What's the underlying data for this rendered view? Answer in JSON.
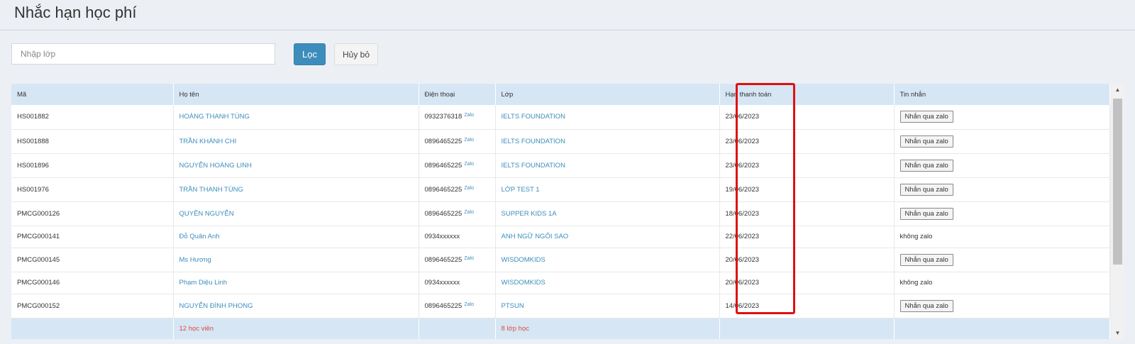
{
  "page": {
    "title": "Nhắc hạn học phí"
  },
  "filter": {
    "placeholder": "Nhập lớp",
    "filter_label": "Lọc",
    "cancel_label": "Hủy bỏ"
  },
  "table": {
    "columns": [
      "Mã",
      "Họ tên",
      "Điện thoại",
      "Lớp",
      "Hạn thanh toán",
      "Tin nhắn"
    ],
    "rows": [
      {
        "code": "HS001882",
        "name": "HOÀNG THANH TÙNG",
        "phone": "0932376318",
        "zalo": "Zalo",
        "class": "IELTS FOUNDATION",
        "due": "23/06/2023",
        "message": "Nhắn qua zalo"
      },
      {
        "code": "HS001888",
        "name": "TRẦN KHÁNH CHI",
        "phone": "0896465225",
        "zalo": "Zalo",
        "class": "IELTS FOUNDATION",
        "due": "23/06/2023",
        "message": "Nhắn qua zalo"
      },
      {
        "code": "HS001896",
        "name": "NGUYỄN HOÀNG LINH",
        "phone": "0896465225",
        "zalo": "Zalo",
        "class": "IELTS FOUNDATION",
        "due": "23/06/2023",
        "message": "Nhắn qua zalo"
      },
      {
        "code": "HS001976",
        "name": "TRẦN THANH TÙNG",
        "phone": "0896465225",
        "zalo": "Zalo",
        "class": "LỚP TEST 1",
        "due": "19/06/2023",
        "message": "Nhắn qua zalo"
      },
      {
        "code": "PMCG000126",
        "name": "QUYÊN NGUYỄN",
        "phone": "0896465225",
        "zalo": "Zalo",
        "class": "SUPPER KIDS 1A",
        "due": "18/06/2023",
        "message": "Nhắn qua zalo"
      },
      {
        "code": "PMCG000141",
        "name": "Đỗ Quân Anh",
        "phone": "0934xxxxxx",
        "zalo": "",
        "class": "ANH NGỮ NGÔI SAO",
        "due": "22/06/2023",
        "message": "không zalo"
      },
      {
        "code": "PMCG000145",
        "name": "Ms Hương",
        "phone": "0896465225",
        "zalo": "Zalo",
        "class": "WISDOMKIDS",
        "due": "20/06/2023",
        "message": "Nhắn qua zalo"
      },
      {
        "code": "PMCG000146",
        "name": "Phạm Diệu Linh",
        "phone": "0934xxxxxx",
        "zalo": "",
        "class": "WISDOMKIDS",
        "due": "20/06/2023",
        "message": "không zalo"
      },
      {
        "code": "PMCG000152",
        "name": "NGUYỄN ĐÌNH PHONG",
        "phone": "0896465225",
        "zalo": "Zalo",
        "class": "PTSUN",
        "due": "14/06/2023",
        "message": "Nhắn qua zalo"
      }
    ],
    "footer": {
      "students": "12 học viên",
      "classes": "8 lớp học"
    }
  },
  "icons": {
    "scroll_up": "triangle-up-icon",
    "scroll_down": "triangle-down-icon"
  },
  "colors": {
    "primary": "#3c8dbc",
    "header_bg": "#d6e6f5",
    "highlight": "#e01010",
    "footer_text": "#dd4b39"
  }
}
